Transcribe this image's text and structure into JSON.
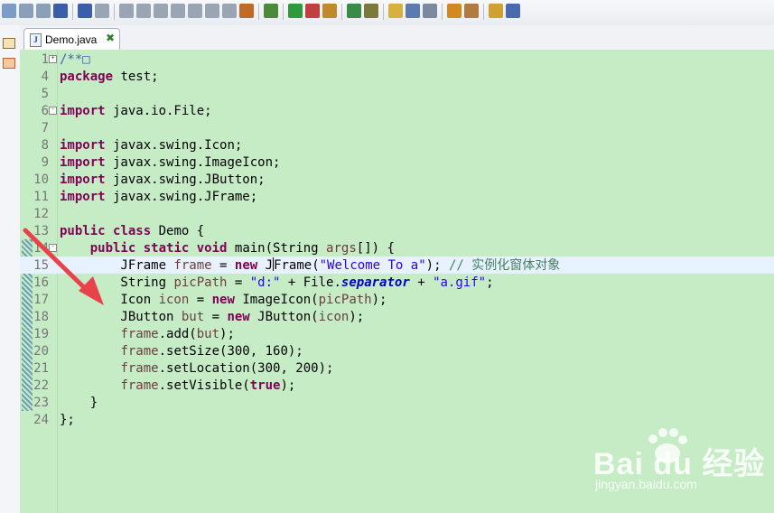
{
  "toolbar": {
    "icons": [
      "new-icon",
      "save-icon",
      "save-all-icon",
      "print-icon",
      "skip-breakpoints-icon",
      "resume-icon",
      "suspend-icon",
      "terminate-icon",
      "disconnect-icon",
      "step-into-icon",
      "step-over-icon",
      "step-return-icon",
      "drop-to-frame-icon",
      "use-step-filters-icon",
      "debug-icon",
      "run-icon",
      "external-tools-icon",
      "new-package-icon",
      "new-class-icon",
      "search-icon",
      "toggle-mark-occurrences-icon",
      "show-whitespace-icon",
      "block-selection-icon",
      "next-annotation-icon",
      "prev-annotation-icon",
      "back-icon",
      "forward-icon"
    ]
  },
  "tab": {
    "label": "Demo.java",
    "file_icon": "J"
  },
  "editor": {
    "lines": [
      {
        "n": "1",
        "code": [
          {
            "t": "/**",
            "c": "cmt"
          },
          {
            "t": "□",
            "c": "cmt"
          }
        ],
        "fold": "+"
      },
      {
        "n": "4",
        "code": [
          {
            "t": "package",
            "c": "kw"
          },
          {
            "t": " test;",
            "c": ""
          }
        ]
      },
      {
        "n": "5",
        "code": []
      },
      {
        "n": "6",
        "code": [
          {
            "t": "import",
            "c": "kw"
          },
          {
            "t": " java.io.File;",
            "c": ""
          }
        ],
        "fold": "-"
      },
      {
        "n": "7",
        "code": []
      },
      {
        "n": "8",
        "code": [
          {
            "t": "import",
            "c": "kw"
          },
          {
            "t": " javax.swing.Icon;",
            "c": ""
          }
        ]
      },
      {
        "n": "9",
        "code": [
          {
            "t": "import",
            "c": "kw"
          },
          {
            "t": " javax.swing.ImageIcon;",
            "c": ""
          }
        ]
      },
      {
        "n": "10",
        "code": [
          {
            "t": "import",
            "c": "kw"
          },
          {
            "t": " javax.swing.JButton;",
            "c": ""
          }
        ]
      },
      {
        "n": "11",
        "code": [
          {
            "t": "import",
            "c": "kw"
          },
          {
            "t": " javax.swing.JFrame;",
            "c": ""
          }
        ]
      },
      {
        "n": "12",
        "code": []
      },
      {
        "n": "13",
        "code": [
          {
            "t": "public",
            "c": "kw"
          },
          {
            "t": " ",
            "c": ""
          },
          {
            "t": "class",
            "c": "kw"
          },
          {
            "t": " Demo {",
            "c": ""
          }
        ]
      },
      {
        "n": "14",
        "code": [
          {
            "t": "    ",
            "c": ""
          },
          {
            "t": "public",
            "c": "kw"
          },
          {
            "t": " ",
            "c": ""
          },
          {
            "t": "static",
            "c": "kw"
          },
          {
            "t": " ",
            "c": ""
          },
          {
            "t": "void",
            "c": "kw"
          },
          {
            "t": " main(String ",
            "c": ""
          },
          {
            "t": "args",
            "c": "var"
          },
          {
            "t": "[]) {",
            "c": ""
          }
        ],
        "fold": "-"
      },
      {
        "n": "15",
        "code": [
          {
            "t": "        JFrame ",
            "c": ""
          },
          {
            "t": "frame",
            "c": "var"
          },
          {
            "t": " = ",
            "c": ""
          },
          {
            "t": "new",
            "c": "kw"
          },
          {
            "t": " J",
            "c": ""
          },
          {
            "t": "|",
            "c": "caret"
          },
          {
            "t": "Frame(",
            "c": ""
          },
          {
            "t": "\"Welcome To a\"",
            "c": "str"
          },
          {
            "t": "); ",
            "c": ""
          },
          {
            "t": "// 实例化窗体对象",
            "c": "lcmt"
          }
        ],
        "current": true
      },
      {
        "n": "16",
        "code": [
          {
            "t": "        String ",
            "c": ""
          },
          {
            "t": "picPath",
            "c": "var"
          },
          {
            "t": " = ",
            "c": ""
          },
          {
            "t": "\"d:\"",
            "c": "str"
          },
          {
            "t": " + File.",
            "c": ""
          },
          {
            "t": "separator",
            "c": "stat"
          },
          {
            "t": " + ",
            "c": ""
          },
          {
            "t": "\"a.gif\"",
            "c": "str"
          },
          {
            "t": ";",
            "c": ""
          }
        ]
      },
      {
        "n": "17",
        "code": [
          {
            "t": "        Icon ",
            "c": ""
          },
          {
            "t": "icon",
            "c": "var"
          },
          {
            "t": " = ",
            "c": ""
          },
          {
            "t": "new",
            "c": "kw"
          },
          {
            "t": " ImageIcon(",
            "c": ""
          },
          {
            "t": "picPath",
            "c": "var"
          },
          {
            "t": ");",
            "c": ""
          }
        ]
      },
      {
        "n": "18",
        "code": [
          {
            "t": "        JButton ",
            "c": ""
          },
          {
            "t": "but",
            "c": "var"
          },
          {
            "t": " = ",
            "c": ""
          },
          {
            "t": "new",
            "c": "kw"
          },
          {
            "t": " JButton(",
            "c": ""
          },
          {
            "t": "icon",
            "c": "var"
          },
          {
            "t": ");",
            "c": ""
          }
        ]
      },
      {
        "n": "19",
        "code": [
          {
            "t": "        ",
            "c": ""
          },
          {
            "t": "frame",
            "c": "var"
          },
          {
            "t": ".add(",
            "c": ""
          },
          {
            "t": "but",
            "c": "var"
          },
          {
            "t": ");",
            "c": ""
          }
        ]
      },
      {
        "n": "20",
        "code": [
          {
            "t": "        ",
            "c": ""
          },
          {
            "t": "frame",
            "c": "var"
          },
          {
            "t": ".setSize(300, 160);",
            "c": ""
          }
        ]
      },
      {
        "n": "21",
        "code": [
          {
            "t": "        ",
            "c": ""
          },
          {
            "t": "frame",
            "c": "var"
          },
          {
            "t": ".setLocation(300, 200);",
            "c": ""
          }
        ]
      },
      {
        "n": "22",
        "code": [
          {
            "t": "        ",
            "c": ""
          },
          {
            "t": "frame",
            "c": "var"
          },
          {
            "t": ".setVisible(",
            "c": ""
          },
          {
            "t": "true",
            "c": "kw"
          },
          {
            "t": ");",
            "c": ""
          }
        ]
      },
      {
        "n": "23",
        "code": [
          {
            "t": "    }",
            "c": ""
          }
        ]
      },
      {
        "n": "24",
        "code": [
          {
            "t": "};",
            "c": ""
          }
        ]
      }
    ]
  },
  "watermark": {
    "brand": "Bai du 经验",
    "url": "jingyan.baidu.com"
  },
  "colors": {
    "editor_bg": "#c6ecc6",
    "current_line": "#e8f2fe",
    "keyword": "#7f0055",
    "string": "#2a00ff",
    "arrow": "#e8434a"
  }
}
